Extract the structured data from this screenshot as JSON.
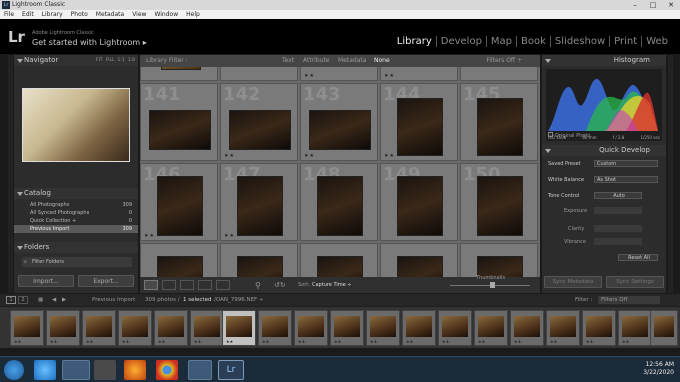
{
  "window": {
    "title": "Lightroom Classic",
    "app_badge": "Lr",
    "controls": [
      "–",
      "□",
      "✕"
    ]
  },
  "menu": [
    "File",
    "Edit",
    "Library",
    "Photo",
    "Metadata",
    "View",
    "Window",
    "Help"
  ],
  "identity": {
    "logo": "Lr",
    "subtitle": "Adobe Lightroom Classic",
    "title": "Get started with Lightroom ▸"
  },
  "modules": [
    {
      "label": "Library",
      "active": true
    },
    {
      "label": "Develop",
      "active": false
    },
    {
      "label": "Map",
      "active": false
    },
    {
      "label": "Book",
      "active": false
    },
    {
      "label": "Slideshow",
      "active": false
    },
    {
      "label": "Print",
      "active": false
    },
    {
      "label": "Web",
      "active": false
    }
  ],
  "navigator": {
    "title": "Navigator",
    "zoom": [
      "FIT",
      "FILL",
      "1:1",
      "1:8"
    ]
  },
  "catalog": {
    "title": "Catalog",
    "items": [
      {
        "label": "All Photographs",
        "count": "309"
      },
      {
        "label": "All Synced Photographs",
        "count": "0"
      },
      {
        "label": "Quick Collection +",
        "count": "0"
      },
      {
        "label": "Previous Import",
        "count": "309",
        "selected": true
      }
    ]
  },
  "folders": {
    "title": "Folders",
    "filter": "Filter Folders"
  },
  "left_buttons": {
    "import": "Import...",
    "export": "Export..."
  },
  "filterbar": {
    "title": "Library Filter :",
    "tabs": [
      "Text",
      "Attribute",
      "Metadata",
      "None"
    ],
    "preset": "Filters Off ÷"
  },
  "grid": {
    "numbers": [
      "141",
      "142",
      "143",
      "144",
      "145",
      "146",
      "147",
      "148",
      "149",
      "150"
    ],
    "stars": "★★"
  },
  "toolbar": {
    "sort_label": "Sort:",
    "sort_value": "Capture Time ÷",
    "thumb_label": "Thumbnails"
  },
  "histogram": {
    "title": "Histogram",
    "info": [
      "ISO 1600",
      "66 mm",
      "f / 2.8",
      "1/250 sec"
    ],
    "original": "Original Photo"
  },
  "quick_develop": {
    "title": "Quick Develop",
    "rows": [
      {
        "label": "Saved Preset",
        "value": "Custom"
      },
      {
        "label": "White Balance",
        "value": "As Shot"
      },
      {
        "label": "Tone Control",
        "value": "Auto"
      }
    ],
    "sliders": [
      "Exposure",
      "Clarity",
      "Vibrance"
    ],
    "reset": "Reset All"
  },
  "right_buttons": {
    "sync_meta": "Sync Metadata",
    "sync_set": "Sync Settings"
  },
  "filmbar": {
    "pages": [
      "1",
      "2"
    ],
    "source": "Previous Import",
    "count_text": "309 photos /",
    "selected_text": "1 selected",
    "file": "/OAN_7996.NEF ÷",
    "filter_label": "Filter :",
    "filter_value": "Filters Off"
  },
  "clock": {
    "time": "12:56 AM",
    "date": "3/22/2020"
  },
  "colors": {
    "accent": "#eeeeee",
    "panel": "#2c2c2c",
    "grid_bg": "#6a6a6a"
  }
}
